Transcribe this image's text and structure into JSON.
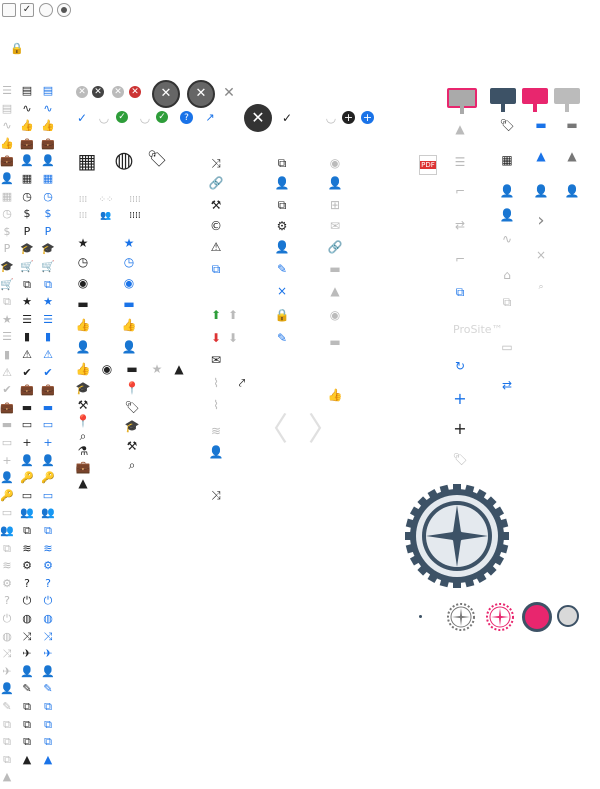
{
  "controls": {
    "checkbox_checked_mark": "✓"
  },
  "buttons": {
    "close_mark": "✕",
    "tick_mark": "✓",
    "plus_mark": "+",
    "help_mark": "?",
    "chevron_left": "〈",
    "chevron_right": "〉",
    "chevron_small": "›",
    "cross_small": "×",
    "pdf_label": "PDF"
  },
  "labels": {
    "provisite": "ProSite™"
  },
  "colors": {
    "accent_blue": "#1a73e8",
    "accent_pink": "#e8266e",
    "gear_slate": "#3d5266",
    "dark_grey": "#555555",
    "light_grey": "#d6d6d6"
  },
  "icon_columns": {
    "col1_glyphs": [
      "☰",
      "▤",
      "∿",
      "👍",
      "💼",
      "👤",
      "▦",
      "◷",
      "$",
      "P",
      "🎓",
      "🛒",
      "⧉",
      "★",
      "☰",
      "▮",
      "⚠",
      "✔",
      "💼",
      "▬",
      "▭",
      "+",
      "👤",
      "🔑",
      "▭",
      "👥",
      "⧉",
      "≋",
      "⚙",
      "?",
      "⏻",
      "◍",
      "⤨",
      "✈",
      "👤",
      "✎",
      "⧉",
      "⧉",
      "⧉",
      "▲"
    ],
    "col2_glyphs": [
      "▤",
      "∿",
      "👍",
      "💼",
      "👤",
      "▦",
      "◷",
      "$",
      "P",
      "🎓",
      "🛒",
      "⧉",
      "★",
      "☰",
      "▮",
      "⚠",
      "✔",
      "💼",
      "▬",
      "▭",
      "+",
      "👤",
      "🔑",
      "▭",
      "👥",
      "⧉",
      "≋",
      "⚙",
      "?",
      "⏻",
      "◍",
      "⤨",
      "✈",
      "👤",
      "✎",
      "⧉",
      "⧉",
      "⧉",
      "▲"
    ]
  }
}
